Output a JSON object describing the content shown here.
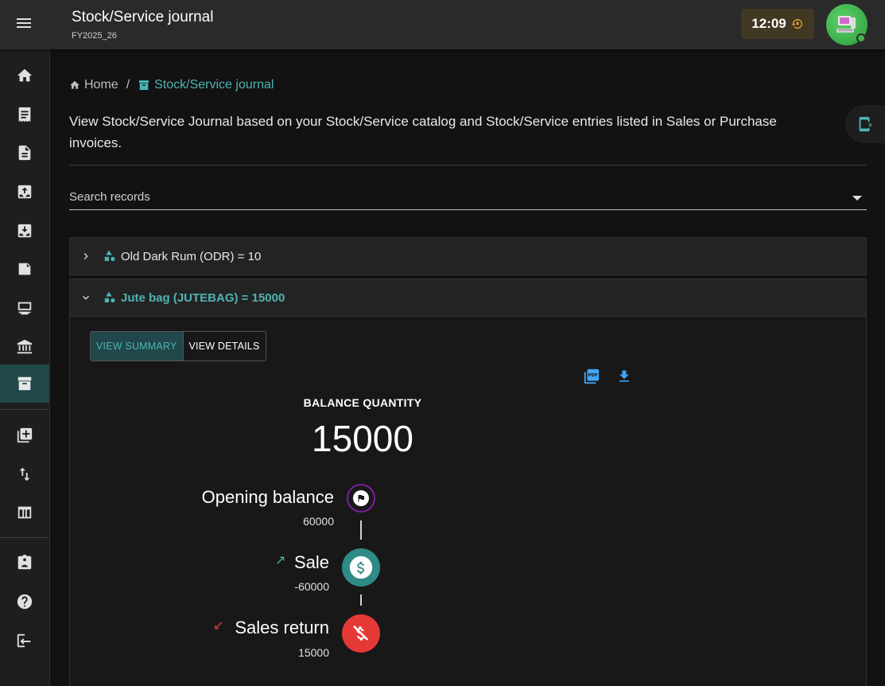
{
  "header": {
    "title": "Stock/Service journal",
    "subtitle": "FY2025_26",
    "clock": "12:09"
  },
  "sidebar": {
    "items": [
      {
        "name": "home-icon"
      },
      {
        "name": "receipt-icon"
      },
      {
        "name": "document-icon"
      },
      {
        "name": "inbox-upload-icon"
      },
      {
        "name": "inbox-download-icon"
      },
      {
        "name": "note-icon"
      },
      {
        "name": "printer-icon"
      },
      {
        "name": "bank-icon"
      },
      {
        "name": "archive-icon",
        "active": true
      },
      {
        "name": "add-library-icon"
      },
      {
        "name": "swap-vertical-icon"
      },
      {
        "name": "table-icon"
      },
      {
        "name": "clipboard-account-icon"
      },
      {
        "name": "help-icon"
      },
      {
        "name": "logout-icon"
      }
    ]
  },
  "breadcrumb": {
    "home": "Home",
    "separator": "/",
    "current": "Stock/Service journal"
  },
  "description": "View Stock/Service Journal based on your Stock/Service catalog and Stock/Service entries listed in Sales or Purchase invoices.",
  "search": {
    "label": "Search records"
  },
  "accordion": [
    {
      "title": "Old Dark Rum (ODR) = 10",
      "expanded": false
    },
    {
      "title": "Jute bag (JUTEBAG) = 15000",
      "expanded": true
    }
  ],
  "summary": {
    "tab_summary": "VIEW SUMMARY",
    "tab_details": "VIEW DETAILS",
    "balance_label": "BALANCE QUANTITY",
    "balance_value": "15000",
    "timeline": [
      {
        "label": "Opening balance",
        "value": "60000"
      },
      {
        "label": "Sale",
        "value": "-60000"
      },
      {
        "label": "Sales return",
        "value": "15000"
      }
    ]
  },
  "colors": {
    "accent": "#4fb3b3",
    "sale_node": "#2e8b86",
    "return_node": "#e53935",
    "opening_ring": "#7b1fa2"
  }
}
